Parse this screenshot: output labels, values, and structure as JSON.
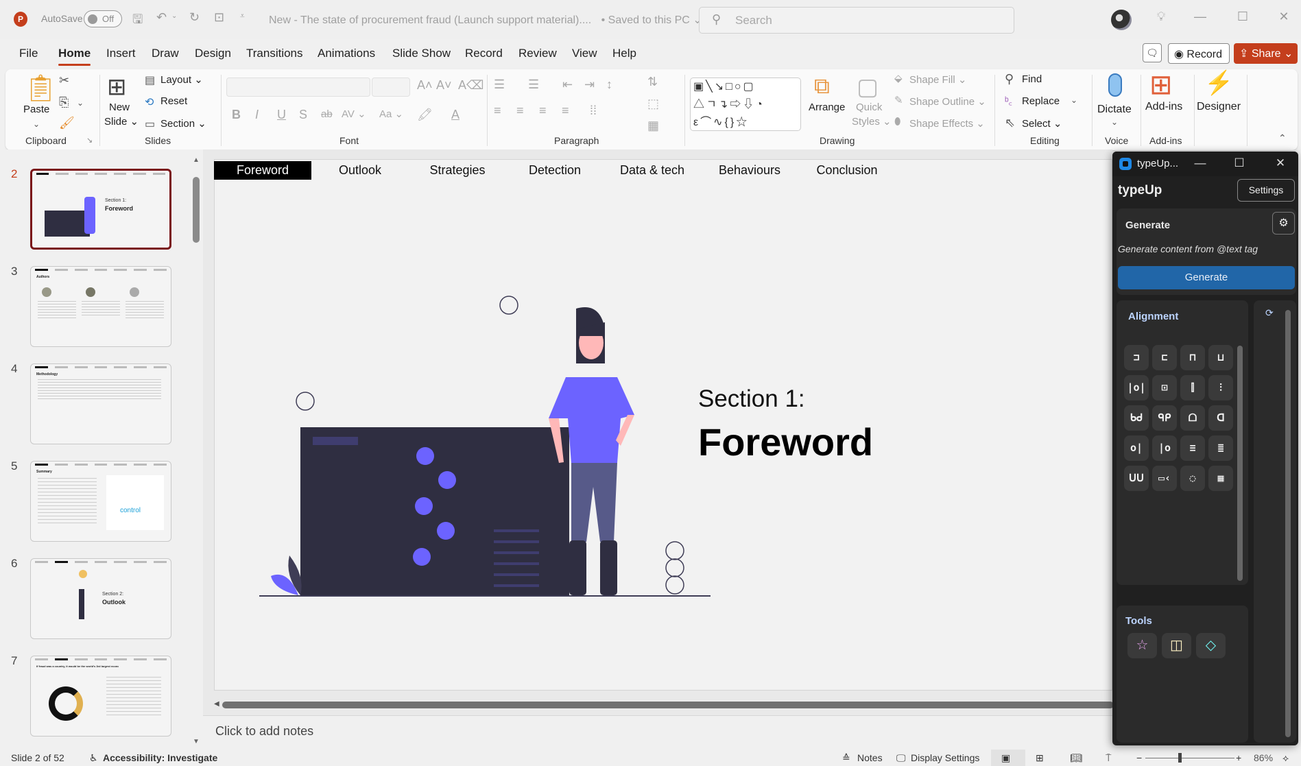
{
  "app": {
    "logo_letter": "P",
    "autosave_label": "AutoSave",
    "autosave_state": "Off",
    "document_title": "New - The state of procurement fraud (Launch support material)....",
    "save_status": "• Saved to this PC ⌄",
    "search_placeholder": "Search"
  },
  "menu": {
    "tabs": [
      "File",
      "Home",
      "Insert",
      "Draw",
      "Design",
      "Transitions",
      "Animations",
      "Slide Show",
      "Record",
      "Review",
      "View",
      "Help"
    ],
    "active_tab": "Home",
    "record_label": "Record",
    "share_label": "Share"
  },
  "ribbon": {
    "clipboard": {
      "paste": "Paste",
      "label": "Clipboard"
    },
    "slides": {
      "new_slide_1": "New",
      "new_slide_2": "Slide ⌄",
      "layout": "Layout ⌄",
      "reset": "Reset",
      "section": "Section ⌄",
      "label": "Slides"
    },
    "font": {
      "label": "Font",
      "bold": "B",
      "italic": "I",
      "underline": "U",
      "shadow": "S",
      "strike": "ab",
      "spacing": "AV ⌄",
      "case": "Aa ⌄"
    },
    "paragraph": {
      "label": "Paragraph"
    },
    "drawing": {
      "arrange": "Arrange",
      "quick_styles_1": "Quick",
      "quick_styles_2": "Styles ⌄",
      "shape_fill": "Shape Fill ⌄",
      "shape_outline": "Shape Outline ⌄",
      "shape_effects": "Shape Effects ⌄",
      "label": "Drawing"
    },
    "editing": {
      "find": "Find",
      "replace": "Replace",
      "select": "Select ⌄",
      "label": "Editing"
    },
    "voice": {
      "dictate": "Dictate",
      "label": "Voice"
    },
    "addins": {
      "addins": "Add-ins",
      "label": "Add-ins"
    },
    "designer": {
      "label": "Designer"
    }
  },
  "thumbnails": [
    {
      "num": "2",
      "selected": true,
      "title": "Section 1:",
      "subtitle": "Foreword"
    },
    {
      "num": "3",
      "selected": false,
      "heading": "Authors"
    },
    {
      "num": "4",
      "selected": false,
      "heading": "Methodology"
    },
    {
      "num": "5",
      "selected": false,
      "heading": "Summary",
      "word": "control"
    },
    {
      "num": "6",
      "selected": false,
      "title": "Section 2:",
      "subtitle": "Outlook"
    },
    {
      "num": "7",
      "selected": false,
      "heading": "If fraud was a country, it would be the world's 3rd largest economy"
    }
  ],
  "slide": {
    "nav": [
      "Foreword",
      "Outlook",
      "Strategies",
      "Detection",
      "Data & tech",
      "Behaviours",
      "Conclusion"
    ],
    "active_nav": "Foreword",
    "section_label": "Section 1:",
    "section_title": "Foreword",
    "notes_placeholder": "Click to add notes"
  },
  "status": {
    "slide_count": "Slide 2 of 52",
    "accessibility": "Accessibility: Investigate",
    "notes": "Notes",
    "display_settings": "Display Settings",
    "zoom": "86%",
    "zoom_level_percent": 86
  },
  "typeup": {
    "window_title": "typeUp...",
    "brand": "typeUp",
    "settings": "Settings",
    "generate_heading": "Generate",
    "generate_desc": "Generate content from @text tag",
    "generate_button": "Generate",
    "alignment_heading": "Alignment",
    "alignment_icons": [
      "align-right",
      "align-left",
      "align-top",
      "align-bottom",
      "align-center-vertical-line",
      "align-middle-horizontal",
      "distribute-horizontal",
      "distribute-vertical",
      "stretch-left",
      "stretch-right",
      "stretch-top",
      "stretch-bottom",
      "snap-right",
      "snap-left",
      "snap-top",
      "snap-bottom",
      "group-below",
      "group-right",
      "circle-layout",
      "grid-layout"
    ],
    "tools_heading": "Tools",
    "tools": [
      "star",
      "layout",
      "diamond"
    ],
    "colors": {
      "generate_button": "#2166a8",
      "star": "#e9a6f0",
      "layout": "#fff1c4",
      "diamond": "#6ff0ee"
    }
  }
}
